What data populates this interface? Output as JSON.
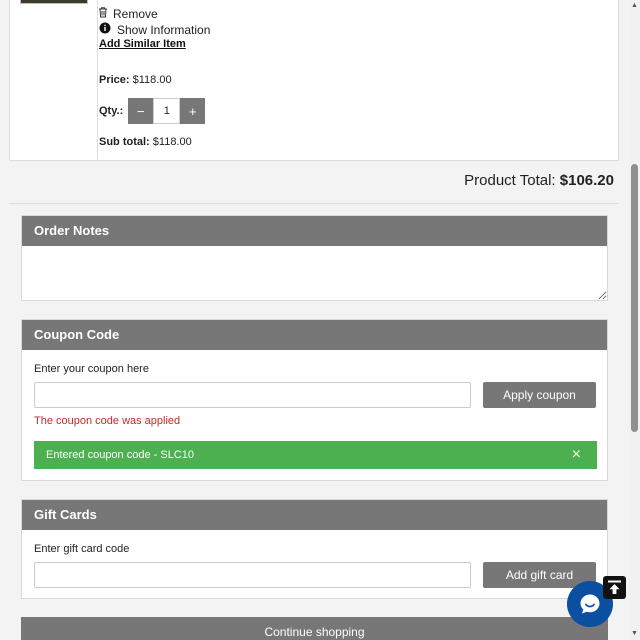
{
  "product": {
    "remove_label": "Remove",
    "info_label": "Show Information",
    "similar_label": "Add Similar Item",
    "price_label": "Price:",
    "price_value": "$118.00",
    "qty_label": "Qty.:",
    "qty_minus": "−",
    "qty_value": "1",
    "qty_plus": "+",
    "subtotal_label": "Sub total:",
    "subtotal_value": "$118.00"
  },
  "totals": {
    "label": "Product Total:",
    "value": "$106.20"
  },
  "order_notes": {
    "title": "Order Notes",
    "value": ""
  },
  "coupon": {
    "title": "Coupon Code",
    "field_label": "Enter your coupon here",
    "input_value": "",
    "apply_label": "Apply coupon",
    "applied_message": "The coupon code was applied",
    "entered_message": "Entered coupon code - SLC10",
    "close_icon": "×"
  },
  "gift_cards": {
    "title": "Gift Cards",
    "field_label": "Enter gift card code",
    "input_value": "",
    "add_label": "Add gift card"
  },
  "continue_label": "Continue shopping",
  "colors": {
    "panel_header": "#777777",
    "success": "#4caf50",
    "error_text": "#c62828",
    "chat": "#0b4fa0"
  },
  "icons": {
    "remove": "trash-icon",
    "info": "info-icon",
    "close": "close-icon",
    "to_top": "arrow-up-to-line-icon",
    "chat": "chat-bubble-icon"
  }
}
